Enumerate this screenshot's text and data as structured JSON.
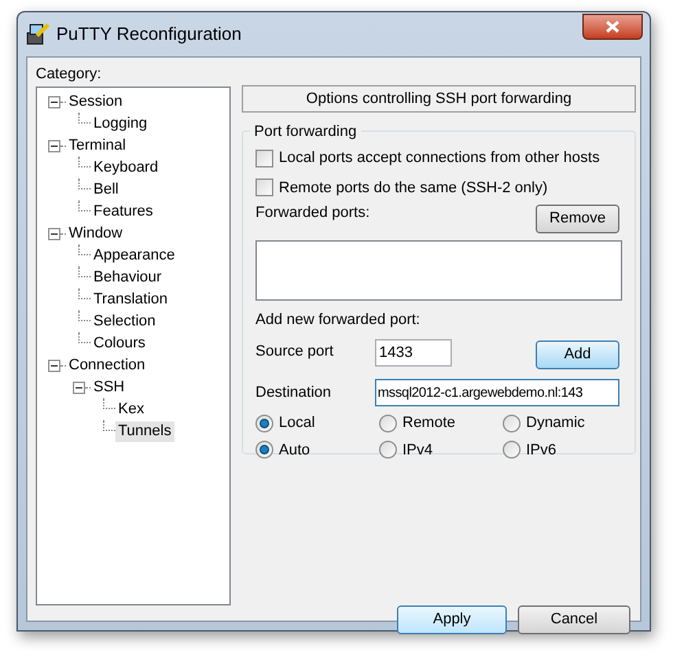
{
  "window": {
    "title": "PuTTY Reconfiguration"
  },
  "category_label": "Category:",
  "tree": [
    {
      "label": "Session",
      "expanded": true,
      "selected": false,
      "children": [
        {
          "label": "Logging",
          "selected": false
        }
      ]
    },
    {
      "label": "Terminal",
      "expanded": true,
      "selected": false,
      "children": [
        {
          "label": "Keyboard",
          "selected": false
        },
        {
          "label": "Bell",
          "selected": false
        },
        {
          "label": "Features",
          "selected": false
        }
      ]
    },
    {
      "label": "Window",
      "expanded": true,
      "selected": false,
      "children": [
        {
          "label": "Appearance",
          "selected": false
        },
        {
          "label": "Behaviour",
          "selected": false
        },
        {
          "label": "Translation",
          "selected": false
        },
        {
          "label": "Selection",
          "selected": false
        },
        {
          "label": "Colours",
          "selected": false
        }
      ]
    },
    {
      "label": "Connection",
      "expanded": true,
      "selected": false,
      "children": [
        {
          "label": "SSH",
          "expanded": true,
          "selected": false,
          "children": [
            {
              "label": "Kex",
              "selected": false
            },
            {
              "label": "Tunnels",
              "selected": true
            }
          ]
        }
      ]
    }
  ],
  "panel_header": "Options controlling SSH port forwarding",
  "group": {
    "title": "Port forwarding",
    "checkboxes": [
      {
        "label": "Local ports accept connections from other hosts",
        "checked": false
      },
      {
        "label": "Remote ports do the same (SSH-2 only)",
        "checked": false
      }
    ],
    "forwarded_ports_label": "Forwarded ports:",
    "remove_button": "Remove",
    "add_label": "Add new forwarded port:",
    "source_port": {
      "label": "Source port",
      "value": "1433"
    },
    "add_button": "Add",
    "destination": {
      "label": "Destination",
      "value": "mssql2012-c1.argewebdemo.nl:143"
    },
    "radio_rows": [
      [
        {
          "label": "Local",
          "selected": true
        },
        {
          "label": "Remote",
          "selected": false
        },
        {
          "label": "Dynamic",
          "selected": false
        }
      ],
      [
        {
          "label": "Auto",
          "selected": true
        },
        {
          "label": "IPv4",
          "selected": false
        },
        {
          "label": "IPv6",
          "selected": false
        }
      ]
    ]
  },
  "buttons": [
    {
      "label": "Apply",
      "default": true
    },
    {
      "label": "Cancel",
      "default": false
    }
  ]
}
